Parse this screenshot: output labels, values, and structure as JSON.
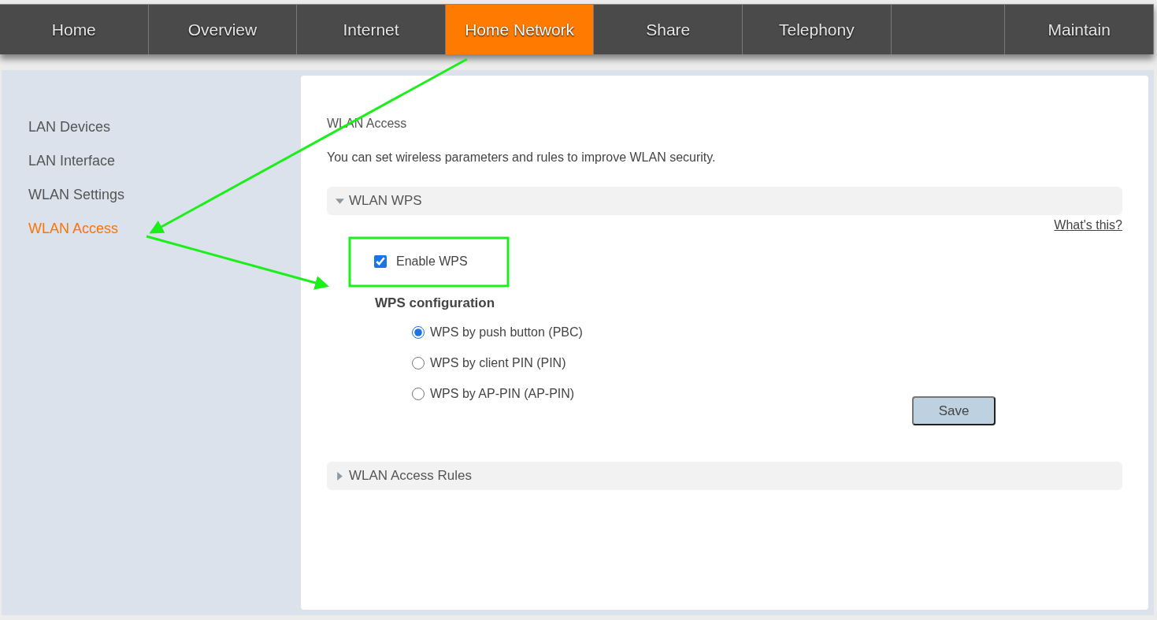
{
  "tabs": [
    {
      "label": "Home",
      "selected": false
    },
    {
      "label": "Overview",
      "selected": false
    },
    {
      "label": "Internet",
      "selected": false
    },
    {
      "label": "Home Network",
      "selected": true
    },
    {
      "label": "Share",
      "selected": false
    },
    {
      "label": "Telephony",
      "selected": false
    },
    {
      "selected": false
    },
    {
      "label": "Maintain",
      "selected": false
    }
  ],
  "sidebar": {
    "items": [
      {
        "label": "LAN Devices",
        "selected": false
      },
      {
        "label": "LAN Interface",
        "selected": false
      },
      {
        "label": "WLAN Settings",
        "selected": false
      },
      {
        "label": "WLAN Access",
        "selected": true
      }
    ]
  },
  "page": {
    "title": "WLAN Access",
    "description": "You can set wireless parameters and rules to improve WLAN security."
  },
  "sections": [
    {
      "title": "WLAN WPS",
      "expanded": true,
      "help_link": "What's this?",
      "enable": {
        "label": "Enable WPS",
        "checked": true
      },
      "config_title": "WPS configuration",
      "options": [
        {
          "label": "WPS by push button (PBC)",
          "selected": true
        },
        {
          "label": "WPS by client PIN (PIN)",
          "selected": false
        },
        {
          "label": "WPS by AP-PIN (AP-PIN)",
          "selected": false
        }
      ],
      "button": "Save"
    },
    {
      "title": "WLAN Access Rules",
      "expanded": false
    }
  ]
}
